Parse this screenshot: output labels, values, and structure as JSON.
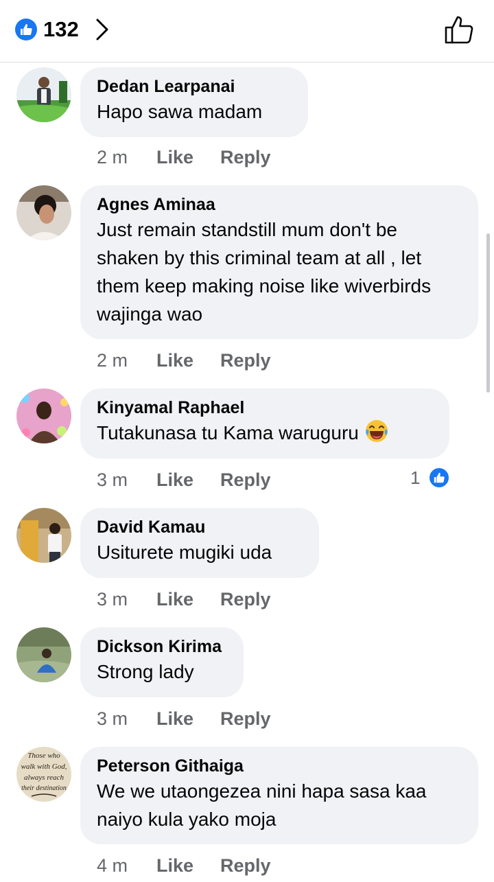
{
  "header": {
    "like_count": "132",
    "reaction_icon": "like-icon",
    "accent_color": "#1877f2"
  },
  "comments": [
    {
      "author": "Dedan Learpanai",
      "text": "Hapo sawa madam",
      "time": "2 m",
      "like_label": "Like",
      "reply_label": "Reply"
    },
    {
      "author": "Agnes Aminaa",
      "text": "Just remain standstill mum don't be shaken by this criminal team at all , let them keep making noise like wiverbirds  wajinga wao",
      "time": "2 m",
      "like_label": "Like",
      "reply_label": "Reply"
    },
    {
      "author": "Kinyamal Raphael",
      "text": "Tutakunasa tu Kama waruguru",
      "emoji": "laughing-face-emoji",
      "time": "3 m",
      "like_label": "Like",
      "reply_label": "Reply",
      "reaction_count": "1"
    },
    {
      "author": "David Kamau",
      "text": "Usiturete mugiki uda",
      "time": "3 m",
      "like_label": "Like",
      "reply_label": "Reply"
    },
    {
      "author": "Dickson Kirima",
      "text": "Strong lady",
      "time": "3 m",
      "like_label": "Like",
      "reply_label": "Reply"
    },
    {
      "author": "Peterson Githaiga",
      "text": "We we utaongezea nini hapa sasa kaa naiyo kula yako moja",
      "time": "4 m",
      "like_label": "Like",
      "reply_label": "Reply",
      "avatar_text": [
        "Those who",
        "walk with God,",
        "always reach",
        "their destination"
      ]
    }
  ]
}
